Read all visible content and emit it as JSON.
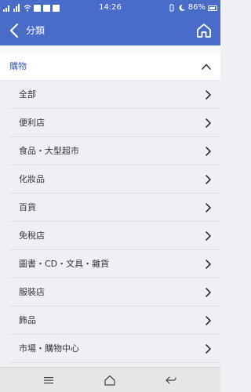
{
  "status_bar": {
    "time": "14:26",
    "battery": "86%"
  },
  "header": {
    "title": "分類"
  },
  "section": {
    "title": "購物"
  },
  "items": [
    {
      "label": "全部"
    },
    {
      "label": "便利店"
    },
    {
      "label": "食品・大型超市"
    },
    {
      "label": "化妝品"
    },
    {
      "label": "百貨"
    },
    {
      "label": "免稅店"
    },
    {
      "label": "圖書・CD・文具・雜貨"
    },
    {
      "label": "服裝店"
    },
    {
      "label": "飾品"
    },
    {
      "label": "市場・購物中心"
    }
  ],
  "colors": {
    "header_blue": "#4a6cc9",
    "section_blue": "#3b59b8"
  },
  "icons": {
    "back": "chevron-left-icon",
    "home": "home-icon",
    "expand": "chevron-up-icon",
    "item": "chevron-right-icon",
    "nav_menu": "menu-icon",
    "nav_home": "home-outline-icon",
    "nav_back": "back-arrow-icon"
  }
}
